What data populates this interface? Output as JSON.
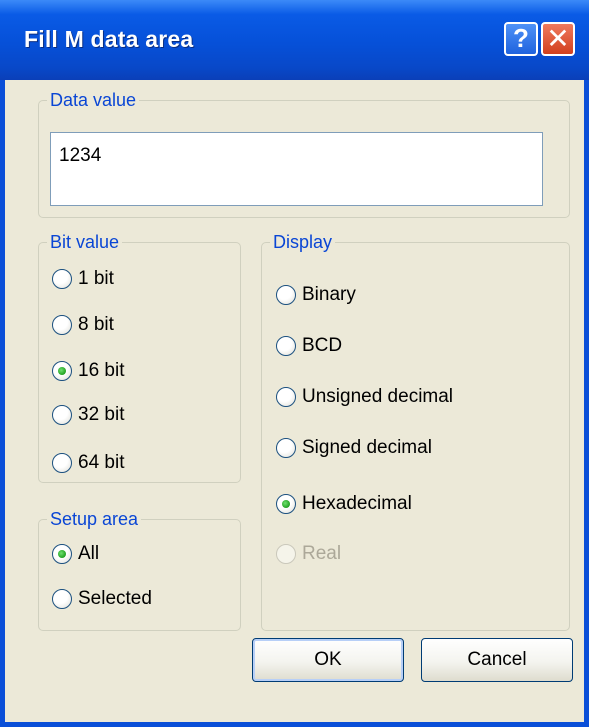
{
  "window": {
    "title": "Fill M data area"
  },
  "titlebar": {
    "help_icon": "?",
    "close_icon": "✕"
  },
  "data_value": {
    "group_label": "Data value",
    "value": "1234"
  },
  "bit_value": {
    "group_label": "Bit value",
    "options": [
      "1 bit",
      "8 bit",
      "16 bit",
      "32 bit",
      "64 bit"
    ],
    "selected": "16 bit"
  },
  "setup_area": {
    "group_label": "Setup area",
    "options": [
      "All",
      "Selected"
    ],
    "selected": "All"
  },
  "display": {
    "group_label": "Display",
    "options": [
      "Binary",
      "BCD",
      "Unsigned decimal",
      "Signed decimal",
      "Hexadecimal",
      "Real"
    ],
    "selected": "Hexadecimal",
    "disabled": [
      "Real"
    ]
  },
  "buttons": {
    "ok": "OK",
    "cancel": "Cancel"
  },
  "colors": {
    "titlebar": "#0a5be6",
    "dialog_bg": "#ece9d8",
    "group_label": "#0a46d5"
  }
}
